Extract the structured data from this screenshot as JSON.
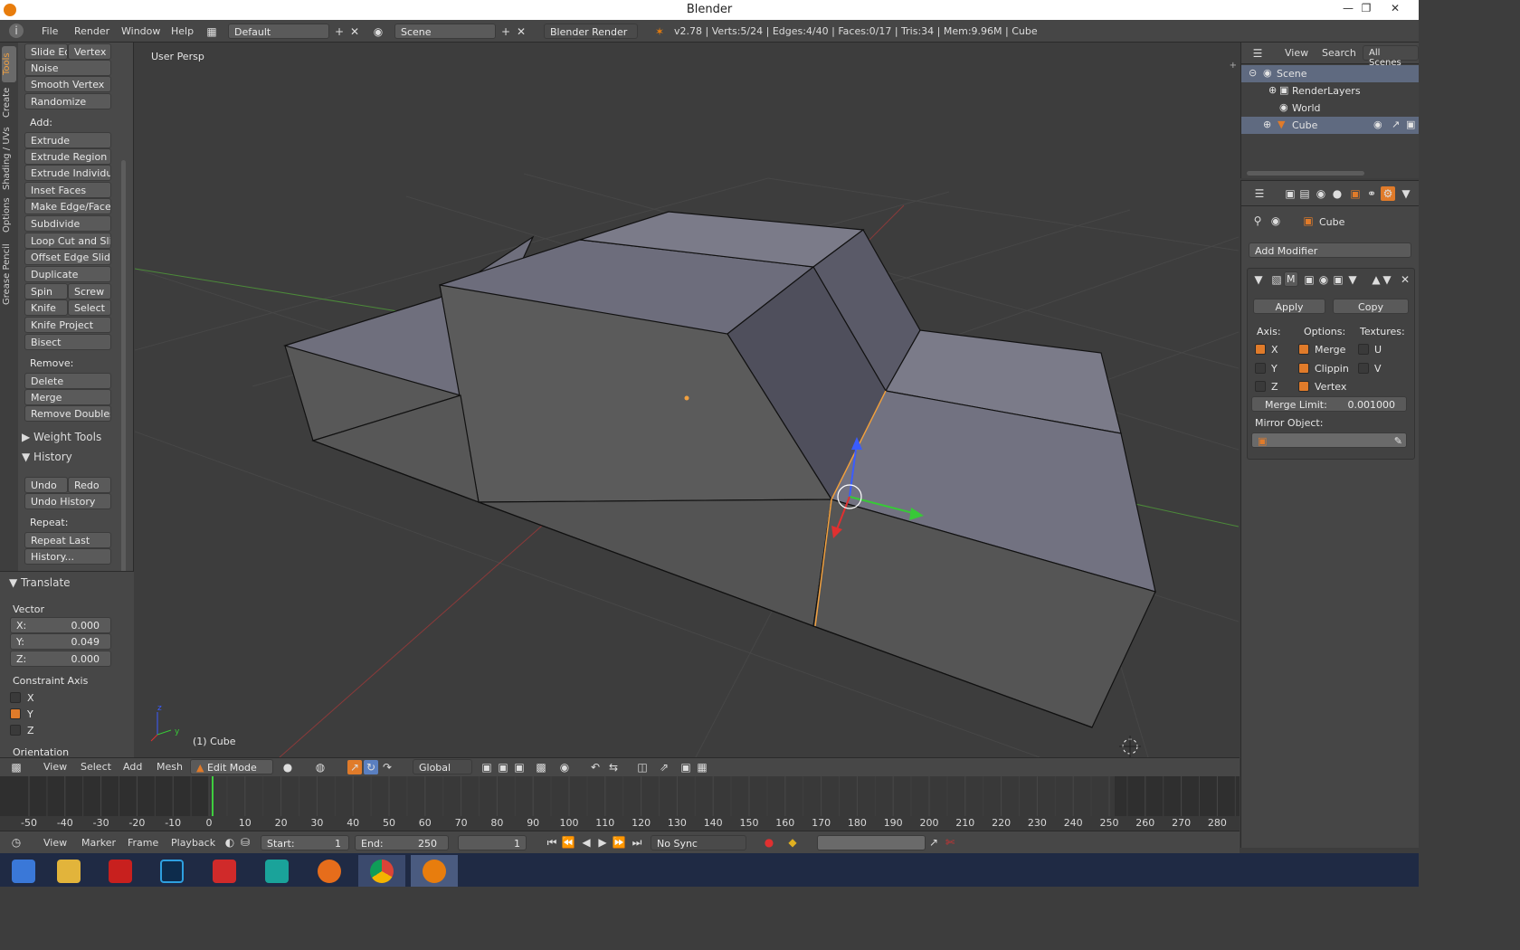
{
  "window": {
    "title": "Blender"
  },
  "infobar": {
    "menus": [
      "File",
      "Render",
      "Window",
      "Help"
    ],
    "layout": "Default",
    "scene": "Scene",
    "engine": "Blender Render",
    "stats": "v2.78 | Verts:5/24 | Edges:4/40 | Faces:0/17 | Tris:34 | Mem:9.96M | Cube"
  },
  "vtabs": [
    "Tools",
    "Create",
    "Shading / UVs",
    "Options",
    "Grease Pencil"
  ],
  "tools": {
    "slide_ed": "Slide Ed",
    "vertex": "Vertex",
    "noise": "Noise",
    "smooth_vertex": "Smooth Vertex",
    "randomize": "Randomize",
    "add_label": "Add:",
    "extrude": "Extrude",
    "extrude_region": "Extrude Region",
    "extrude_individual": "Extrude Individual",
    "inset_faces": "Inset Faces",
    "make_edge_face": "Make Edge/Face",
    "subdivide": "Subdivide",
    "loop_cut": "Loop Cut and Slide",
    "offset_edge": "Offset Edge Slide",
    "duplicate": "Duplicate",
    "spin": "Spin",
    "screw": "Screw",
    "knife": "Knife",
    "select": "Select",
    "knife_project": "Knife Project",
    "bisect": "Bisect",
    "remove_label": "Remove:",
    "delete": "Delete",
    "merge": "Merge",
    "remove_doubles": "Remove Doubles",
    "weight_tools": "Weight Tools",
    "history": "History",
    "undo": "Undo",
    "redo": "Redo",
    "undo_history": "Undo History",
    "repeat_label": "Repeat:",
    "repeat_last": "Repeat Last",
    "history_dots": "History..."
  },
  "operator": {
    "title": "Translate",
    "vector_label": "Vector",
    "x_label": "X:",
    "x_value": "0.000",
    "y_label": "Y:",
    "y_value": "0.049",
    "z_label": "Z:",
    "z_value": "0.000",
    "constraint_label": "Constraint Axis",
    "cx": "X",
    "cy": "Y",
    "cz": "Z",
    "orientation": "Orientation"
  },
  "viewport": {
    "view_name": "User Persp",
    "object_label": "(1) Cube"
  },
  "view3d_header": {
    "view": "View",
    "select": "Select",
    "add": "Add",
    "mesh": "Mesh",
    "mode": "Edit Mode",
    "orientation": "Global"
  },
  "timeline": {
    "ticks": [
      "-50",
      "-40",
      "-30",
      "-20",
      "-10",
      "0",
      "10",
      "20",
      "30",
      "40",
      "50",
      "60",
      "70",
      "80",
      "90",
      "100",
      "110",
      "120",
      "130",
      "140",
      "150",
      "160",
      "170",
      "180",
      "190",
      "200",
      "210",
      "220",
      "230",
      "240",
      "250",
      "260",
      "270",
      "280"
    ],
    "current_frame": 1
  },
  "time_header": {
    "view": "View",
    "marker": "Marker",
    "frame": "Frame",
    "playback": "Playback",
    "start_label": "Start:",
    "start": "1",
    "end_label": "End:",
    "end": "250",
    "frame_value": "1",
    "sync": "No Sync"
  },
  "outliner": {
    "view": "View",
    "search": "Search",
    "all_scenes": "All Scenes",
    "items": [
      "Scene",
      "RenderLayers",
      "World",
      "Cube"
    ]
  },
  "properties": {
    "object": "Cube",
    "add_modifier": "Add Modifier",
    "apply": "Apply",
    "copy": "Copy",
    "axis_label": "Axis:",
    "options_label": "Options:",
    "textures_label": "Textures:",
    "ax": "X",
    "ay": "Y",
    "az": "Z",
    "merge": "Merge",
    "clipping": "Clippin",
    "vertex": "Vertex",
    "u": "U",
    "v": "V",
    "merge_limit_label": "Merge Limit:",
    "merge_limit": "0.001000",
    "mirror_object": "Mirror Object:"
  },
  "colors": {
    "accent": "#e07b2a",
    "selected_edge": "#f0a040"
  }
}
